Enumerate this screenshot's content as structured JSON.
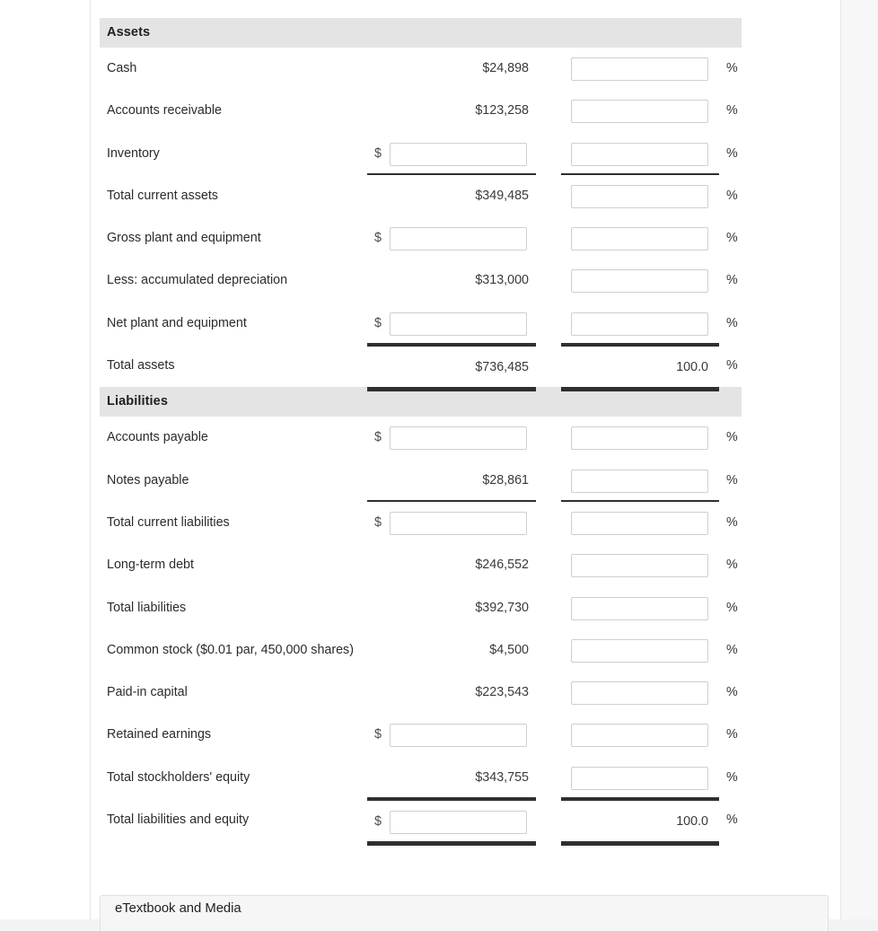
{
  "sections": [
    {
      "name": "assets",
      "title": "Assets",
      "rows": [
        {
          "key": "cash",
          "label": "Cash",
          "dollar_kind": "static",
          "dollar_value": "$24,898",
          "percent_kind": "input",
          "percent_value": "",
          "percent_symbol": "%",
          "rule_top": false,
          "rule_bottom": "none"
        },
        {
          "key": "accounts-receivable",
          "label": "Accounts receivable",
          "dollar_kind": "static",
          "dollar_value": "$123,258",
          "percent_kind": "input",
          "percent_value": "",
          "percent_symbol": "%",
          "rule_top": false,
          "rule_bottom": "none"
        },
        {
          "key": "inventory",
          "label": "Inventory",
          "dollar_kind": "input",
          "dollar_prefix": "$",
          "dollar_value": "",
          "percent_kind": "input",
          "percent_value": "",
          "percent_symbol": "%",
          "rule_top": false,
          "rule_bottom": "single"
        },
        {
          "key": "total-current-assets",
          "label": "Total current assets",
          "dollar_kind": "static",
          "dollar_value": "$349,485",
          "percent_kind": "input",
          "percent_value": "",
          "percent_symbol": "%",
          "rule_top": false,
          "rule_bottom": "none"
        },
        {
          "key": "gross-plant-and-equipment",
          "label": "Gross plant and equipment",
          "dollar_kind": "input",
          "dollar_prefix": "$",
          "dollar_value": "",
          "percent_kind": "input",
          "percent_value": "",
          "percent_symbol": "%",
          "rule_top": false,
          "rule_bottom": "none"
        },
        {
          "key": "less-accumulated-depreciation",
          "label": "Less: accumulated depreciation",
          "dollar_kind": "static",
          "dollar_value": "$313,000",
          "percent_kind": "input",
          "percent_value": "",
          "percent_symbol": "%",
          "rule_top": false,
          "rule_bottom": "none"
        },
        {
          "key": "net-plant-and-equipment",
          "label": "Net plant and equipment",
          "dollar_kind": "input",
          "dollar_prefix": "$",
          "dollar_value": "",
          "percent_kind": "input",
          "percent_value": "",
          "percent_symbol": "%",
          "rule_top": false,
          "rule_bottom": "single"
        },
        {
          "key": "total-assets",
          "label": "Total assets",
          "dollar_kind": "static",
          "dollar_value": "$736,485",
          "percent_kind": "static",
          "percent_value": "100.0",
          "percent_symbol": "%",
          "rule_top": false,
          "rule_bottom": "double"
        }
      ]
    },
    {
      "name": "liabilities",
      "title": "Liabilities",
      "rows": [
        {
          "key": "accounts-payable",
          "label": "Accounts payable",
          "dollar_kind": "input",
          "dollar_prefix": "$",
          "dollar_value": "",
          "percent_kind": "input",
          "percent_value": "",
          "percent_symbol": "%",
          "rule_top": false,
          "rule_bottom": "none"
        },
        {
          "key": "notes-payable",
          "label": "Notes payable",
          "dollar_kind": "static",
          "dollar_value": "$28,861",
          "percent_kind": "input",
          "percent_value": "",
          "percent_symbol": "%",
          "rule_top": false,
          "rule_bottom": "single"
        },
        {
          "key": "total-current-liabilities",
          "label": "Total current liabilities",
          "dollar_kind": "input",
          "dollar_prefix": "$",
          "dollar_value": "",
          "percent_kind": "input",
          "percent_value": "",
          "percent_symbol": "%",
          "rule_top": false,
          "rule_bottom": "none"
        },
        {
          "key": "long-term-debt",
          "label": "Long-term debt",
          "dollar_kind": "static",
          "dollar_value": "$246,552",
          "percent_kind": "input",
          "percent_value": "",
          "percent_symbol": "%",
          "rule_top": false,
          "rule_bottom": "none"
        },
        {
          "key": "total-liabilities",
          "label": "Total liabilities",
          "dollar_kind": "static",
          "dollar_value": "$392,730",
          "percent_kind": "input",
          "percent_value": "",
          "percent_symbol": "%",
          "rule_top": false,
          "rule_bottom": "none"
        },
        {
          "key": "common-stock",
          "label": "Common stock ($0.01 par, 450,000 shares)",
          "dollar_kind": "static",
          "dollar_value": "$4,500",
          "percent_kind": "input",
          "percent_value": "",
          "percent_symbol": "%",
          "rule_top": false,
          "rule_bottom": "none"
        },
        {
          "key": "paid-in-capital",
          "label": "Paid-in capital",
          "dollar_kind": "static",
          "dollar_value": "$223,543",
          "percent_kind": "input",
          "percent_value": "",
          "percent_symbol": "%",
          "rule_top": false,
          "rule_bottom": "none"
        },
        {
          "key": "retained-earnings",
          "label": "Retained earnings",
          "dollar_kind": "input",
          "dollar_prefix": "$",
          "dollar_value": "",
          "percent_kind": "input",
          "percent_value": "",
          "percent_symbol": "%",
          "rule_top": false,
          "rule_bottom": "none"
        },
        {
          "key": "total-stockholders-equity",
          "label": "Total stockholders' equity",
          "dollar_kind": "static",
          "dollar_value": "$343,755",
          "percent_kind": "input",
          "percent_value": "",
          "percent_symbol": "%",
          "rule_top": false,
          "rule_bottom": "single"
        },
        {
          "key": "total-liabilities-and-equity",
          "label": "Total liabilities and equity",
          "dollar_kind": "input",
          "dollar_prefix": "$",
          "dollar_value": "",
          "percent_kind": "static",
          "percent_value": "100.0",
          "percent_symbol": "%",
          "rule_top": false,
          "rule_bottom": "double"
        }
      ]
    }
  ],
  "footer": {
    "etextbook_label": "eTextbook and Media"
  },
  "colors": {
    "section_header_bg": "#e4e4e4",
    "rule": "#2f2f2f",
    "input_border": "#cfcfcf",
    "page_bg": "#f3f3f3"
  }
}
